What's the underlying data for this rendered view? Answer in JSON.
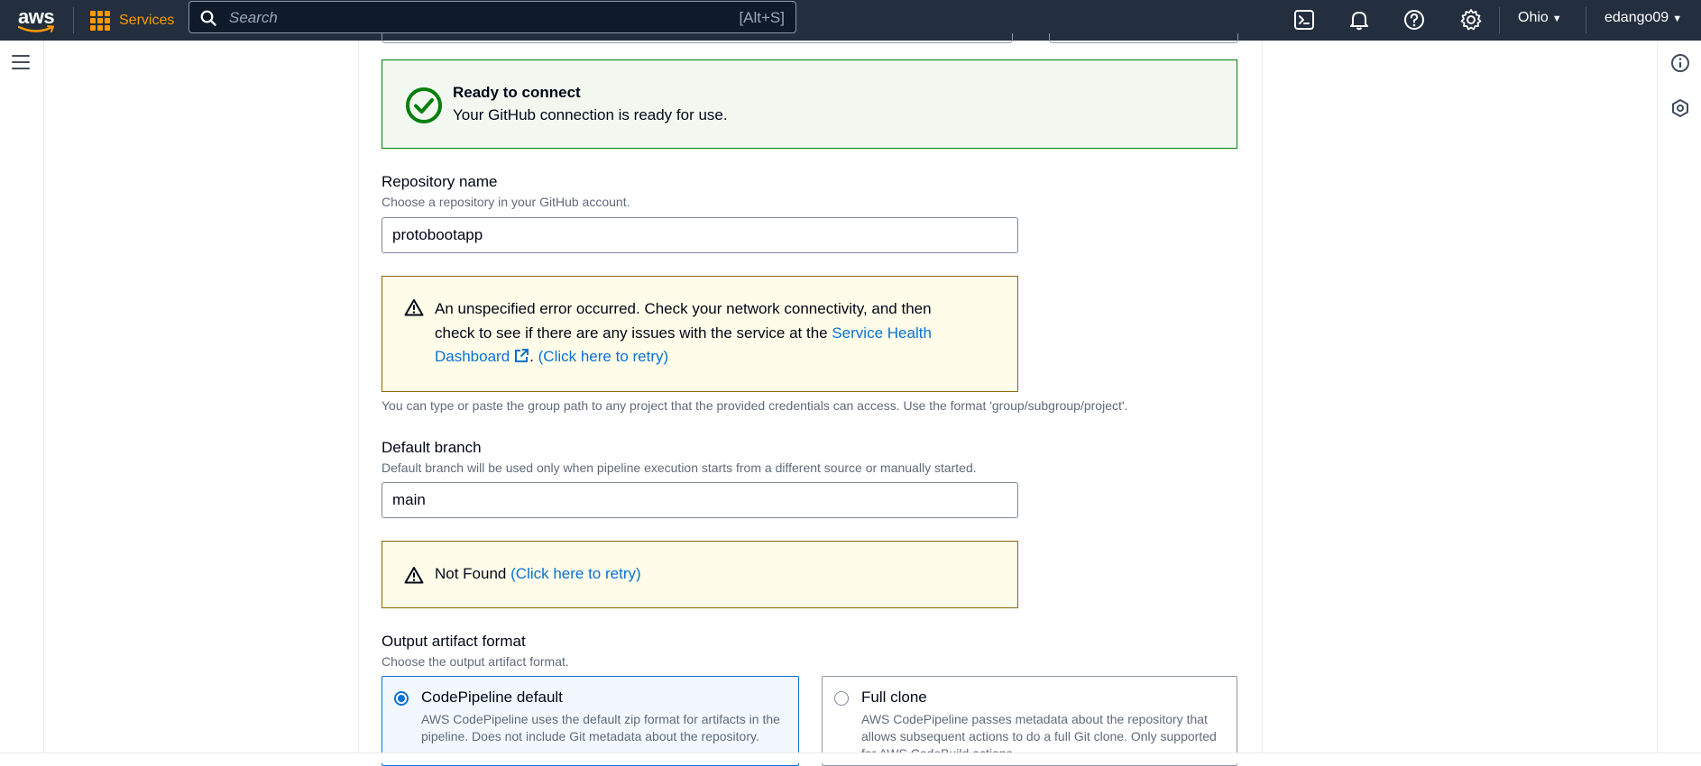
{
  "topnav": {
    "logo": "aws",
    "services_label": "Services",
    "search_placeholder": "Search",
    "search_shortcut": "[Alt+S]",
    "region": "Ohio",
    "user": "edango09",
    "icons": [
      "cloudshell-icon",
      "bell-icon",
      "help-icon",
      "gear-icon"
    ]
  },
  "success_alert": {
    "title": "Ready to connect",
    "message": "Your GitHub connection is ready for use."
  },
  "repository": {
    "label": "Repository name",
    "description": "Choose a repository in your GitHub account.",
    "value": "protobootapp",
    "error": {
      "text_line1": "An unspecified error occurred. Check your network connectivity, and then",
      "text_line2": "check to see if there are any issues with the service at the",
      "link_health_a": "Service Health",
      "link_health_b": "Dashboard",
      "separator": ".",
      "retry": "(Click here to retry)"
    },
    "hint": "You can type or paste the group path to any project that the provided credentials can access. Use the format 'group/subgroup/project'."
  },
  "branch": {
    "label": "Default branch",
    "description": "Default branch will be used only when pipeline execution starts from a different source or manually started.",
    "value": "main",
    "error": {
      "text": "Not Found",
      "retry": "(Click here to retry)"
    }
  },
  "artifact": {
    "label": "Output artifact format",
    "description": "Choose the output artifact format.",
    "options": [
      {
        "title": "CodePipeline default",
        "description": "AWS CodePipeline uses the default zip format for artifacts in the pipeline. Does not include Git metadata about the repository.",
        "selected": true
      },
      {
        "title": "Full clone",
        "description": "AWS CodePipeline passes metadata about the repository that allows subsequent actions to do a full Git clone. Only supported for AWS CodeBuild actions.",
        "selected": false
      }
    ]
  },
  "colors": {
    "nav_bg": "#232f3e",
    "accent_orange": "#ff9900",
    "link_blue": "#0972d3",
    "success_green": "#037f0c",
    "warning_bg": "#fffce9",
    "warning_border": "#8d6605"
  }
}
